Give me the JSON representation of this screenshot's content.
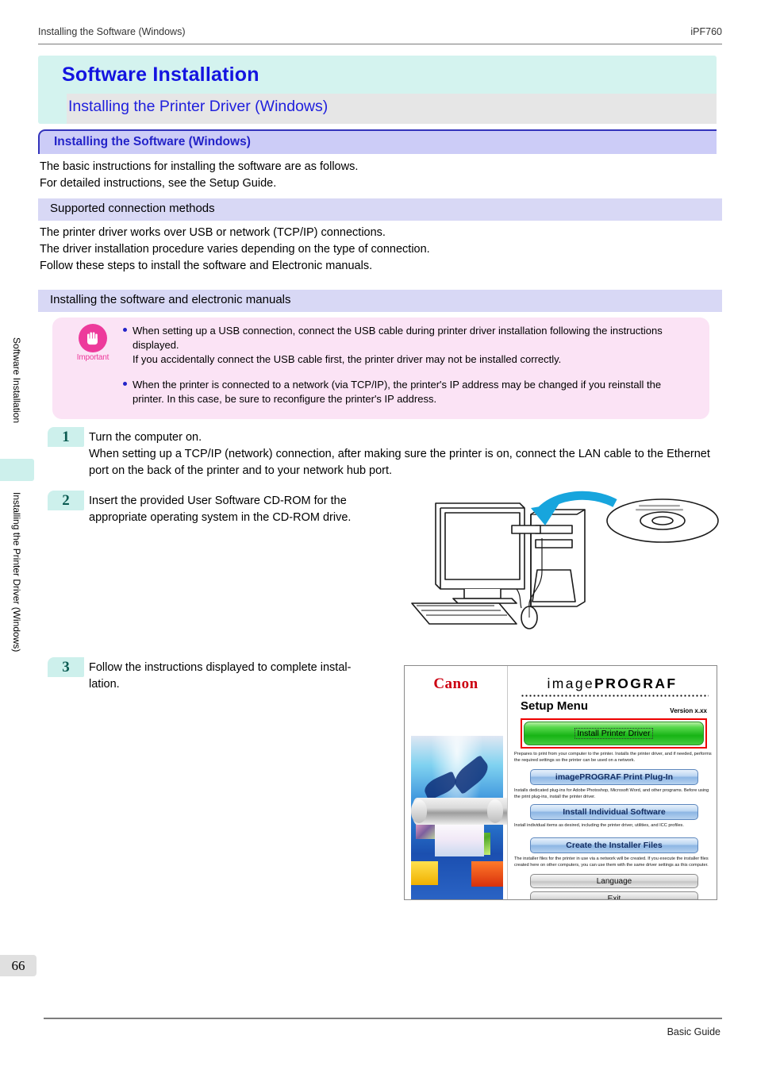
{
  "header": {
    "left": "Installing the Software (Windows)",
    "right": "iPF760"
  },
  "title": {
    "main": "Software Installation",
    "sub": "Installing the Printer Driver (Windows)"
  },
  "section": {
    "heading": "Installing the Software (Windows)",
    "intro_line1": "The basic instructions for installing the software are as follows.",
    "intro_line2": "For detailed instructions, see the Setup Guide."
  },
  "subsections": [
    {
      "heading": "Supported connection methods",
      "body_line1": "The printer driver works over USB or network (TCP/IP) connections.",
      "body_line2": "The driver installation procedure varies depending on the type of connection.",
      "body_line3": "Follow these steps to install the software and Electronic manuals."
    },
    {
      "heading": "Installing the software and electronic manuals"
    }
  ],
  "important": {
    "label": "Important",
    "icon": "hand-stop-icon",
    "items": [
      "When setting up a USB connection, connect the USB cable during printer driver installation following the instructions displayed.\nIf you accidentally connect the USB cable first, the printer driver may not be installed correctly.",
      "When the printer is connected to a network (via TCP/IP), the printer's IP address may be changed if you reinstall the printer. In this case, be sure to reconfigure the printer's IP address."
    ]
  },
  "steps": [
    {
      "number": "1",
      "text": "Turn the computer on.\nWhen setting up a TCP/IP (network) connection, after making sure the printer is on, connect the LAN cable to the Ethernet port on the back of the printer and to your network hub port."
    },
    {
      "number": "2",
      "text": "Insert the provided User Software CD-ROM for the appropriate operating system in the CD-ROM drive."
    },
    {
      "number": "3",
      "text": "Follow the instructions displayed to complete instal-\nlation."
    }
  ],
  "setup_menu": {
    "brand": "Canon",
    "product_light": "image",
    "product_bold": "PROGRAF",
    "menu_title": "Setup Menu",
    "version": "Version x.xx",
    "buttons": [
      {
        "label": "Install Printer Driver",
        "style": "green-highlighted",
        "description": "Prepares to print from your computer to the printer. Installs the printer driver, and if needed, performs the required settings so the printer can be used on a network."
      },
      {
        "label": "imagePROGRAF Print Plug-In",
        "style": "blue",
        "description": "Installs dedicated plug-ins for Adobe Photoshop, Microsoft Word, and other programs. Before using the print plug-ins, install the printer driver."
      },
      {
        "label": "Install Individual Software",
        "style": "blue",
        "description": "Install individual items as desired, including the printer driver, utilities, and ICC profiles."
      },
      {
        "label": "Create the Installer Files",
        "style": "blue",
        "description": "The installer files for the printer in use via a network will be created. If you execute the installer files created here on other computers, you can use them with the same driver settings as this computer."
      },
      {
        "label": "Language",
        "style": "grey",
        "description": ""
      },
      {
        "label": "Exit",
        "style": "grey",
        "description": ""
      }
    ]
  },
  "sidebar": {
    "tabs": [
      {
        "label": "Software Installation"
      },
      {
        "label": "Installing the Printer Driver (Windows)"
      }
    ]
  },
  "footer": {
    "page_number": "66",
    "guide_name": "Basic Guide"
  },
  "colors": {
    "title_blue": "#1414e0",
    "title_bg": "#d4f3ef",
    "section_bg": "#ccccf7",
    "subbar_bg": "#d8d8f5",
    "important_bg": "#fbe3f5",
    "important_pink": "#ed3a9b",
    "step_badge_bg": "#cdf0ec",
    "highlight_red": "#ee0000",
    "canon_red": "#cc0011"
  }
}
